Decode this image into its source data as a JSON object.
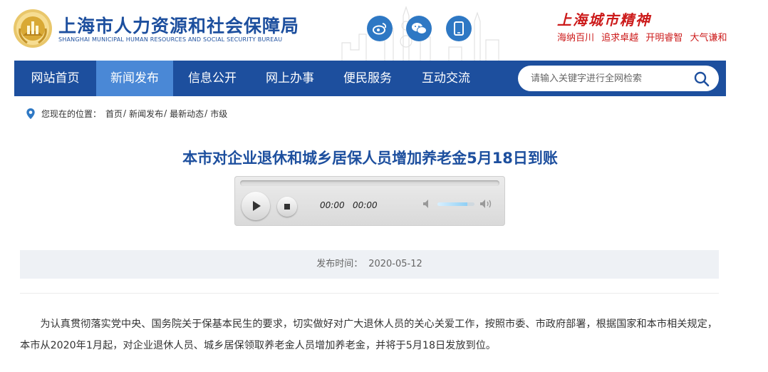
{
  "header": {
    "title": "上海市人力资源和社会保障局",
    "subtitle": "SHANGHAI MUNICIPAL HUMAN RESOURCES AND SOCIAL SECURITY BUREAU",
    "social_icons": [
      "weibo-icon",
      "wechat-icon",
      "mobile-icon"
    ],
    "spirit_title": "上海城市精神",
    "spirit_slogans": [
      "海纳百川",
      "追求卓越",
      "开明睿智",
      "大气谦和"
    ]
  },
  "nav": {
    "items": [
      {
        "label": "网站首页",
        "active": false
      },
      {
        "label": "新闻发布",
        "active": true
      },
      {
        "label": "信息公开",
        "active": false
      },
      {
        "label": "网上办事",
        "active": false
      },
      {
        "label": "便民服务",
        "active": false
      },
      {
        "label": "互动交流",
        "active": false
      }
    ],
    "search_placeholder": "请输入关键字进行全网检索"
  },
  "breadcrumb": {
    "prefix": "您现在的位置：",
    "items": [
      "首页",
      "新闻发布",
      "最新动态",
      "市级"
    ]
  },
  "article": {
    "title": "本市对企业退休和城乡居保人员增加养老金5月18日到账",
    "publish_label": "发布时间：",
    "publish_date": "2020-05-12",
    "paragraph": "为认真贯彻落实党中央、国务院关于保基本民生的要求，切实做好对广大退休人员的关心关爱工作，按照市委、市政府部署，根据国家和本市相关规定，本市从2020年1月起，对企业退休人员、城乡居保领取养老金人员增加养老金，并将于5月18日发放到位。"
  },
  "player": {
    "current_time": "00:00",
    "duration": "00:00",
    "volume_level": 0.8
  },
  "colors": {
    "brand_blue": "#1d4f9e",
    "nav_active": "#4a88d6",
    "social_blue": "#2e78c4",
    "spirit_red": "#cc1a1a",
    "publish_bg": "#eef1f5"
  }
}
